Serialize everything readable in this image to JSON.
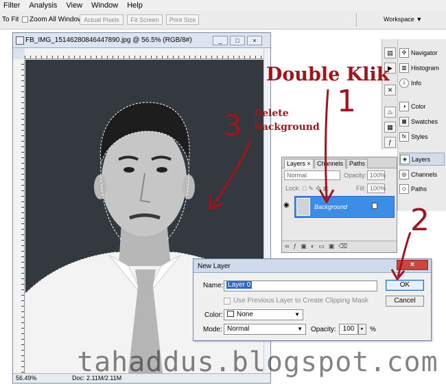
{
  "menu": [
    "Filter",
    "Analysis",
    "View",
    "Window",
    "Help"
  ],
  "options": {
    "fit_label": "To Fit",
    "zoom_all_windows": "Zoom All Windows",
    "actual_pixels": "Actual Pixels",
    "fit_screen": "Fit Screen",
    "print_size": "Print Size",
    "workspace": "Workspace ▼"
  },
  "document": {
    "title": "FB_IMG_15146280846447890.jpg @ 56.5% (RGB/8#)",
    "zoom": "56.49%",
    "doc_size": "Doc: 2.11M/2.11M"
  },
  "panels": [
    {
      "name": "Navigator",
      "icon": "navigator-icon"
    },
    {
      "name": "Histogram",
      "icon": "histogram-icon"
    },
    {
      "name": "Info",
      "icon": "info-icon"
    },
    {
      "name": "Color",
      "icon": "color-icon"
    },
    {
      "name": "Swatches",
      "icon": "swatches-icon"
    },
    {
      "name": "Styles",
      "icon": "styles-icon"
    },
    {
      "name": "Layers",
      "icon": "layers-icon"
    },
    {
      "name": "Channels",
      "icon": "channels-icon"
    },
    {
      "name": "Paths",
      "icon": "paths-icon"
    }
  ],
  "layers_panel": {
    "tabs": [
      "Layers ×",
      "Channels",
      "Paths"
    ],
    "blend_mode": "Normal",
    "opacity_label": "Opacity:",
    "opacity_value": "100%",
    "lock_label": "Lock:",
    "fill_label": "Fill:",
    "fill_value": "100%",
    "layer_name": "Background"
  },
  "dialog": {
    "title": "New Layer",
    "name_label": "Name:",
    "name_value": "Layer 0",
    "clip_label": "Use Previous Layer to Create Clipping Mask",
    "color_label": "Color:",
    "color_value": "None",
    "mode_label": "Mode:",
    "mode_value": "Normal",
    "opacity_label": "Opacity:",
    "opacity_value": "100",
    "percent": "%",
    "ok": "OK",
    "cancel": "Cancel",
    "close": "×"
  },
  "annotations": {
    "double_klik": "Double Klik",
    "step1": "1",
    "step2": "2",
    "step3": "3",
    "delete_bg_line1": "Delete",
    "delete_bg_line2": "Background",
    "color": "#a0141e"
  },
  "watermark": "tahaddus.blogspot.com"
}
